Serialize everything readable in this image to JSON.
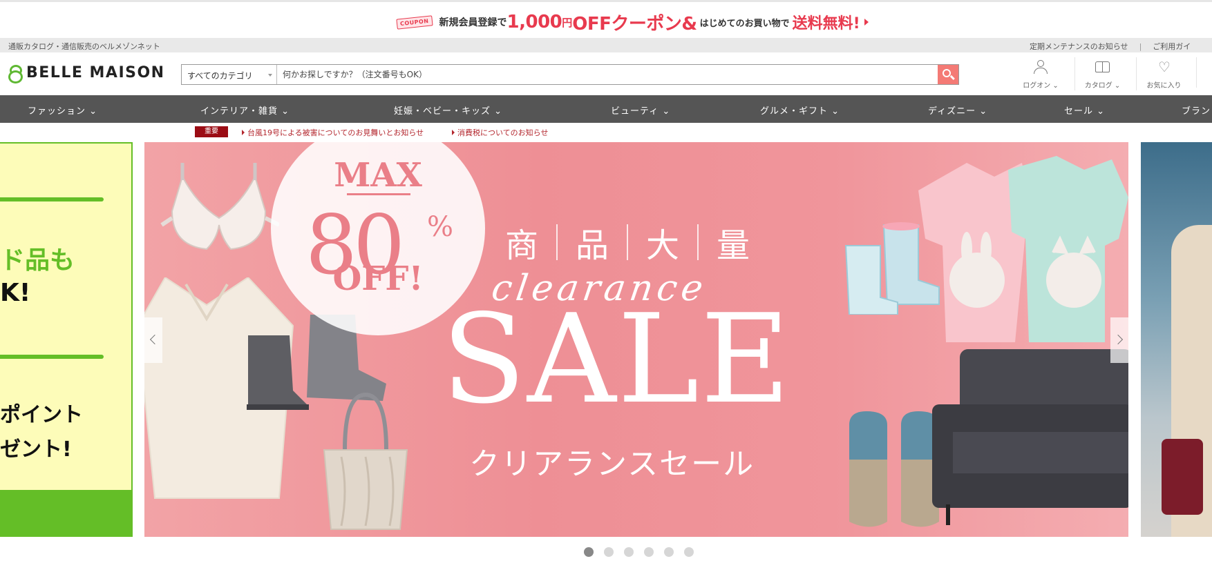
{
  "coupon_bar": {
    "badge": "COUPON",
    "text_1": "新規会員登録で",
    "amount": "1,000",
    "unit": "円",
    "off_text": "OFFクーポン&",
    "text_2": "はじめてのお買い物で",
    "free_shipping": "送料無料!"
  },
  "util_bar": {
    "site_description": "通販カタログ・通信販売のベルメゾンネット",
    "maintenance_link": "定期メンテナンスのお知らせ",
    "separator": "|",
    "guide_link": "ご利用ガイ"
  },
  "header": {
    "logo_text": "BELLE MAISON",
    "search": {
      "category": "すべてのカテゴリ",
      "placeholder": "何かお探しですか？（注文番号もOK）"
    },
    "login_label": "ログオン",
    "catalog_label": "カタログ",
    "favorites_label": "お気に入り"
  },
  "nav": {
    "items": [
      {
        "label": "ファッション"
      },
      {
        "label": "インテリア・雑貨"
      },
      {
        "label": "妊娠・ベビー・キッズ"
      },
      {
        "label": "ビューティ"
      },
      {
        "label": "グルメ・ギフト"
      },
      {
        "label": "ディズニー"
      },
      {
        "label": "セール"
      },
      {
        "label": "ブラン"
      }
    ]
  },
  "notice": {
    "badge": "重要",
    "links": [
      {
        "label": "台風19号による被害についてのお見舞いとお知らせ"
      },
      {
        "label": "消費税についてのお知らせ"
      }
    ]
  },
  "carousel": {
    "prev_slide": {
      "line_1": "ド品も",
      "line_2": "K!",
      "line_3": "ポイント",
      "line_4": "ゼント!"
    },
    "main_slide": {
      "max_label": "MAX",
      "max_value": "80",
      "percent": "%",
      "off_label": "OFF!",
      "headline_chars": [
        "商",
        "品",
        "大",
        "量"
      ],
      "cursive": "clearance",
      "sale": "SALE",
      "subtitle": "クリアランスセール"
    },
    "dot_count": 6,
    "active_dot": 0
  },
  "colors": {
    "accent": "#e83a4e",
    "brand_green": "#5fb833",
    "nav_bg": "#555555",
    "banner_pink": "#ee8f95",
    "search_button": "#f47a75",
    "notice_red": "#9b0c14"
  }
}
